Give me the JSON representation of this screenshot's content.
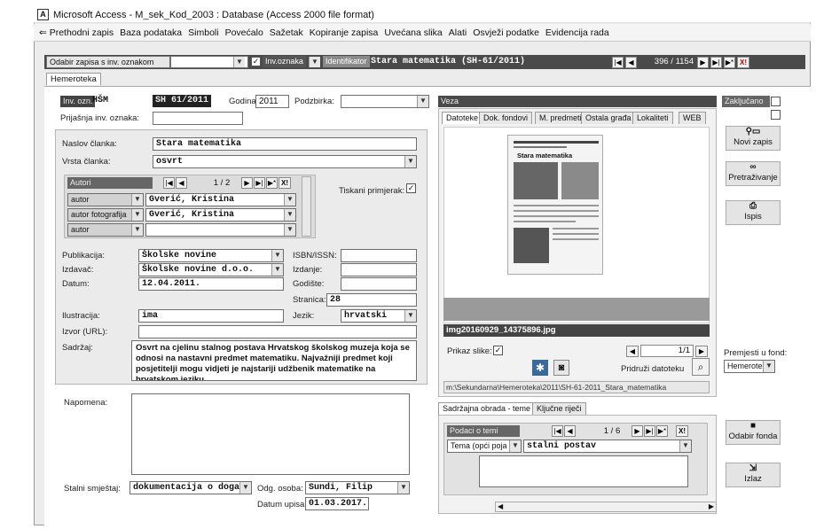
{
  "window": {
    "title": "Microsoft Access - M_sek_Kod_2003 : Database (Access 2000 file format)",
    "app_icon_letter": "A"
  },
  "menu": {
    "items": [
      "⇐ Prethodni zapis",
      "Baza podataka",
      "Simboli",
      "Povećalo",
      "Sažetak",
      "Kopiranje zapisa",
      "Uvećana slika",
      "Alati",
      "Osvježi podatke",
      "Evidencija rada"
    ]
  },
  "topbar": {
    "select_label": "Odabir zapisa s inv. oznakom",
    "inv_label": "Inv.oznaka",
    "identifier_label": "Identifikator",
    "identifier_value": "Stara matematika (SH-61/2011)",
    "record_counter": "396 / 1154"
  },
  "tabs": {
    "main": "Hemeroteka"
  },
  "record": {
    "inv_label": "Inv. ozn.",
    "inv_prefix": "HŠM",
    "inv_value": "SH 61/2011",
    "year_label": "Godina:",
    "year_value": "2011",
    "subcollection_label": "Podzbirka:",
    "subcollection_value": "",
    "prev_inv_label": "Prijašnja inv. oznaka:",
    "prev_inv_value": "",
    "locked_label": "Zaključano"
  },
  "article": {
    "title_label": "Naslov članka:",
    "title_value": "Stara matematika",
    "type_label": "Vrsta članka:",
    "type_value": "osvrt",
    "authors_header": "Autori",
    "authors_counter": "1 / 2",
    "authors": [
      {
        "role": "autor",
        "name": "Gverić, Kristina"
      },
      {
        "role": "autor fotografija",
        "name": "Gverić, Kristina"
      },
      {
        "role": "autor",
        "name": ""
      }
    ],
    "printed_label": "Tiskani primjerak:",
    "printed_checked": true
  },
  "publication": {
    "pub_label": "Publikacija:",
    "pub_value": "Školske novine",
    "publisher_label": "Izdavač:",
    "publisher_value": "Školske novine d.o.o.",
    "date_label": "Datum:",
    "date_value": "12.04.2011.",
    "isbn_label": "ISBN/ISSN:",
    "isbn_value": "",
    "edition_label": "Izdanje:",
    "edition_value": "",
    "volume_label": "Godište:",
    "volume_value": "",
    "page_label": "Stranica:",
    "page_value": "28",
    "illustration_label": "Ilustracija:",
    "illustration_value": "ima",
    "language_label": "Jezik:",
    "language_value": "hrvatski",
    "source_label": "Izvor (URL):",
    "source_value": "",
    "content_label": "Sadržaj:",
    "content_value": "Osvrt na cjelinu stalnog postava Hrvatskog školskog muzeja koja se odnosi na nastavni predmet matematiku. Najvažniji predmet koji posjetitelji mogu vidjeti je najstariji udžbenik matematike na hrvatskom jeziku..."
  },
  "notes": {
    "label": "Napomena:",
    "value": ""
  },
  "location": {
    "label": "Stalni smještaj:",
    "value": "dokumentacija o događa",
    "person_label": "Odg. osoba:",
    "person_value": "Sundi, Filip",
    "entry_label": "Datum upisa:",
    "entry_value": "01.03.2017."
  },
  "links": {
    "header": "Veza",
    "tabs": [
      "Datoteke",
      "Dok. fondovi",
      "M. predmeti",
      "Ostala građa",
      "Lokaliteti",
      "WEB"
    ],
    "file_name": "img20160929_14375896.jpg",
    "show_image_label": "Prikaz slike:",
    "show_image_checked": true,
    "file_counter": "1/1",
    "attach_label": "Pridruži datoteku",
    "path": "m:\\Sekundarna\\Hemeroteka\\2011\\SH-61-2011_Stara_matematika",
    "thumb_headline": "Stara matematika"
  },
  "topics": {
    "tabs": [
      "Sadržajna obrada - teme",
      "Ključne riječi"
    ],
    "header": "Podaci o temi",
    "counter": "1 / 6",
    "category": "Tema (opći poja",
    "value": "stalni postav"
  },
  "side": {
    "new_record": "Novi zapis",
    "search": "Pretraživanje",
    "print": "Ispis",
    "move_label": "Premjesti u fond:",
    "move_value": "Hemeroteka",
    "choose_fond": "Odabir fonda",
    "exit": "Izlaz"
  },
  "colors": {
    "dark_header": "#4a4a4a",
    "panel": "#ebebeb",
    "accent_red": "#c03030"
  }
}
